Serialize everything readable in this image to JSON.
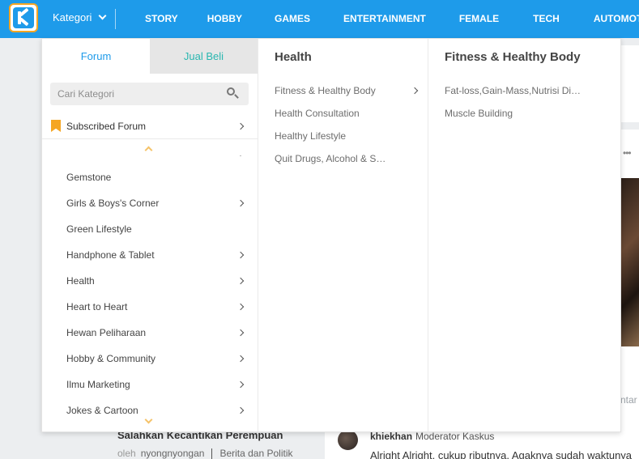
{
  "header": {
    "kategori_label": "Kategori",
    "nav": [
      "STORY",
      "HOBBY",
      "GAMES",
      "ENTERTAINMENT",
      "FEMALE",
      "TECH",
      "AUTOMOTIVE"
    ]
  },
  "menu": {
    "tabs": [
      {
        "label": "Forum",
        "active": true
      },
      {
        "label": "Jual Beli",
        "active": false
      }
    ],
    "search_placeholder": "Cari Kategori",
    "subscribed_label": "Subscribed Forum",
    "categories": [
      {
        "label": "Gemstone",
        "has_sub": false
      },
      {
        "label": "Girls & Boys's Corner",
        "has_sub": true
      },
      {
        "label": "Green Lifestyle",
        "has_sub": false
      },
      {
        "label": "Handphone & Tablet",
        "has_sub": true
      },
      {
        "label": "Health",
        "has_sub": true
      },
      {
        "label": "Heart to Heart",
        "has_sub": true
      },
      {
        "label": "Hewan Peliharaan",
        "has_sub": true
      },
      {
        "label": "Hobby & Community",
        "has_sub": true
      },
      {
        "label": "Ilmu Marketing",
        "has_sub": true
      },
      {
        "label": "Jokes & Cartoon",
        "has_sub": true
      }
    ],
    "health": {
      "title": "Health",
      "items": [
        {
          "label": "Fitness & Healthy Body",
          "has_sub": true
        },
        {
          "label": "Health Consultation",
          "has_sub": false
        },
        {
          "label": "Healthy Lifestyle",
          "has_sub": false
        },
        {
          "label": "Quit Drugs, Alcohol & Smoking",
          "has_sub": false
        }
      ]
    },
    "fitness": {
      "title": "Fitness & Healthy Body",
      "items": [
        "Fat-loss,Gain-Mass,Nutrisi Die…",
        "Muscle Building"
      ]
    }
  },
  "background": {
    "thread_title": "Salahkan Kecantikan Perempuan",
    "by_label": "oleh",
    "author": "nyongnyongan",
    "forum": "Berita dan Politik",
    "comment_user": "khiekhan",
    "comment_role": "Moderator Kaskus",
    "comment_text": "Alright Alright, cukup ributnya. Agaknya sudah waktunya",
    "dots": "•••",
    "side_text": "ntar"
  },
  "colors": {
    "brand_blue": "#1e9bea",
    "accent_orange": "#f5a623",
    "teal": "#2ab7b0"
  }
}
